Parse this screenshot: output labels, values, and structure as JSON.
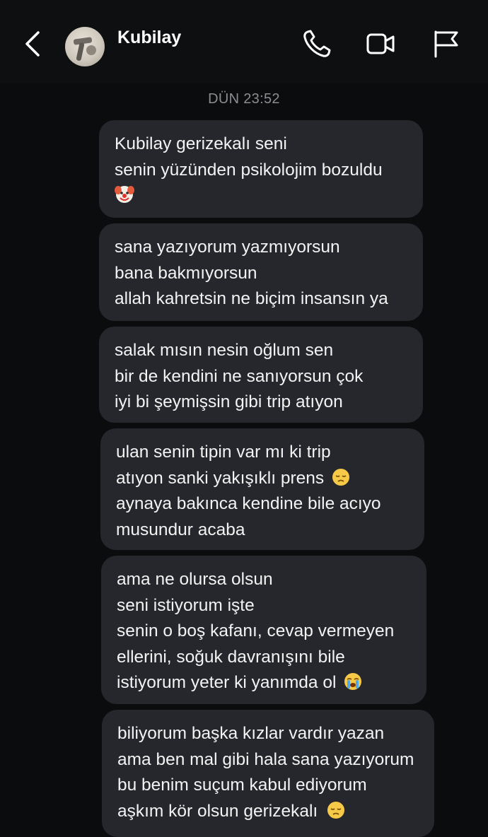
{
  "header": {
    "contact_name": "Kubilay",
    "back_icon": "chevron-left-icon",
    "call_icon": "phone-icon",
    "video_icon": "video-camera-icon",
    "report_icon": "flag-icon"
  },
  "timestamp": "DÜN 23:52",
  "messages": [
    {
      "lines": [
        "Kubilay gerizekalı seni",
        "senin yüzünden psikolojim bozuldu",
        ""
      ],
      "emoji": "clown-face"
    },
    {
      "lines": [
        "sana yazıyorum yazmıyorsun",
        "bana bakmıyorsun",
        "allah kahretsin ne biçim insansın ya"
      ]
    },
    {
      "lines": [
        "salak mısın nesin oğlum sen",
        "bir de kendini ne sanıyorsun çok",
        "iyi bi şeymişsin gibi trip atıyon"
      ]
    },
    {
      "lines": [
        "ulan senin tipin var mı ki trip",
        "atıyon sanki yakışıklı prens",
        "aynaya bakınca kendine bile acıyo",
        "musundur acaba"
      ],
      "emoji": "pensive-face"
    },
    {
      "lines": [
        "ama ne olursa olsun",
        "seni istiyorum işte",
        "senin o boş kafanı, cevap vermeyen",
        "ellerini, soğuk davranışını bile",
        "istiyorum yeter ki yanımda ol"
      ],
      "emoji": "loudly-crying-face"
    },
    {
      "lines": [
        "biliyorum başka kızlar vardır yazan",
        "ama ben mal gibi hala sana yazıyorum",
        "bu benim suçum kabul ediyorum",
        "aşkım kör olsun gerizekalı"
      ],
      "emoji": "pensive-face"
    }
  ],
  "colors": {
    "background": "#0b0c0e",
    "bubble": "#25272c",
    "text": "#f3f3f3",
    "timestamp": "#8c8d91"
  }
}
